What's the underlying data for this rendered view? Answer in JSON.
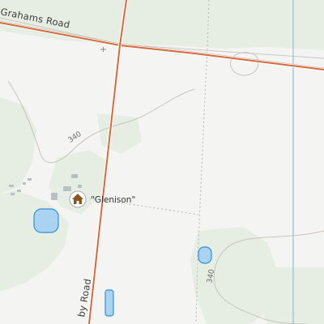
{
  "map": {
    "roads": [
      {
        "name": "Grahams Road",
        "display": "Grahams Road"
      },
      {
        "name": "...by Road",
        "display": "by Road"
      }
    ],
    "contours": [
      {
        "label": "340"
      },
      {
        "label": "340"
      }
    ],
    "places": [
      {
        "label": "\"Glenison\"",
        "icon": "homestead-icon"
      }
    ],
    "colors": {
      "land": "#f4f5f3",
      "vegetation": "#e6eee3",
      "road_main": "#d46a3a",
      "road_casing": "#9a4a26",
      "track": "#b8b8b8",
      "contour": "#c9c3bb",
      "water": "#a9d3f0",
      "water_outline": "#2f8fd6",
      "boundary": "#7fb3d9",
      "homestead_icon": "#8a5520"
    }
  }
}
